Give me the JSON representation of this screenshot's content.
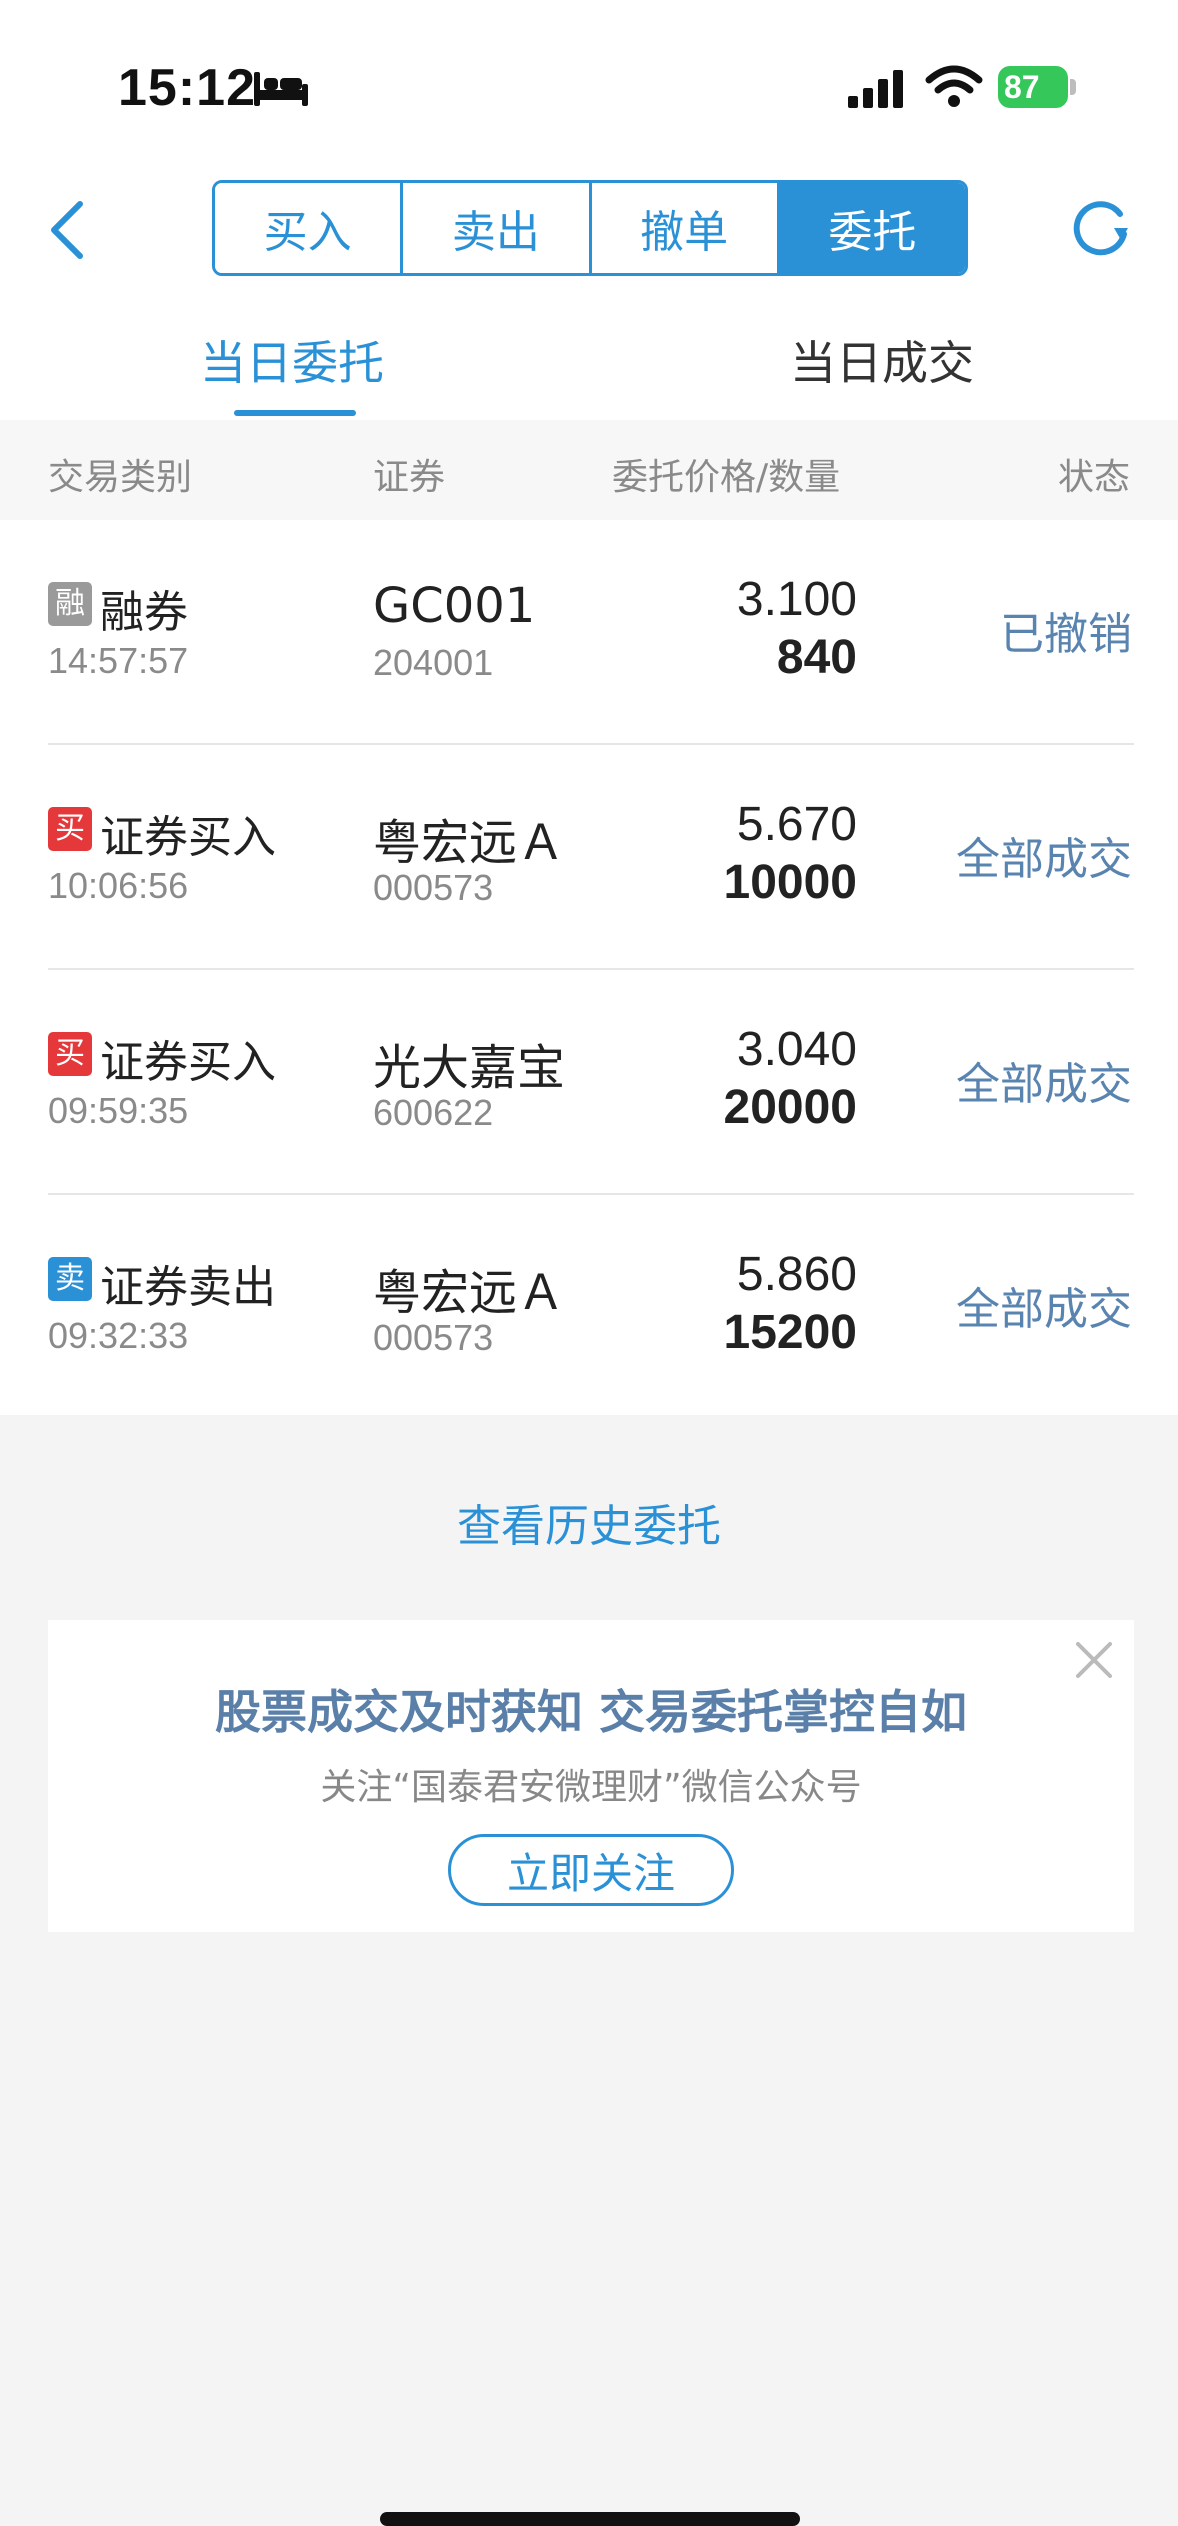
{
  "status_bar": {
    "time": "15:12",
    "battery": "87"
  },
  "header": {
    "segments": [
      {
        "label": "买入",
        "active": false
      },
      {
        "label": "卖出",
        "active": false
      },
      {
        "label": "撤单",
        "active": false
      },
      {
        "label": "委托",
        "active": true
      }
    ],
    "accent_color": "#2b91d6"
  },
  "subtabs": {
    "today_orders": "当日委托",
    "today_trades": "当日成交",
    "active": "today_orders"
  },
  "columns": {
    "type": "交易类别",
    "security": "证券",
    "price_qty": "委托价格/数量",
    "status": "状态"
  },
  "orders": [
    {
      "badge": "融",
      "badge_color": "#9a9a9a",
      "type": "融券",
      "time": "14:57:57",
      "name": "GC001",
      "code": "204001",
      "price": "3.100",
      "qty": "840",
      "status": "已撤销"
    },
    {
      "badge": "买",
      "badge_color": "#e5383b",
      "type": "证券买入",
      "time": "10:06:56",
      "name": "粤宏远Ａ",
      "code": "000573",
      "price": "5.670",
      "qty": "10000",
      "status": "全部成交"
    },
    {
      "badge": "买",
      "badge_color": "#e5383b",
      "type": "证券买入",
      "time": "09:59:35",
      "name": "光大嘉宝",
      "code": "600622",
      "price": "3.040",
      "qty": "20000",
      "status": "全部成交"
    },
    {
      "badge": "卖",
      "badge_color": "#2b91d6",
      "type": "证券卖出",
      "time": "09:32:33",
      "name": "粤宏远Ａ",
      "code": "000573",
      "price": "5.860",
      "qty": "15200",
      "status": "全部成交"
    }
  ],
  "history_link": "查看历史委托",
  "promo": {
    "title": "股票成交及时获知 交易委托掌控自如",
    "subtitle": "关注“国泰君安微理财”微信公众号",
    "button": "立即关注"
  }
}
